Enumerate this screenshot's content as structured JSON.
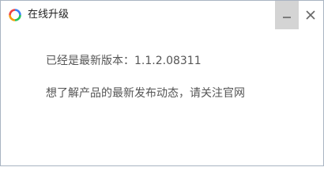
{
  "window": {
    "title": "在线升级",
    "minimize_icon": "minimize-icon",
    "close_icon": "close-icon"
  },
  "content": {
    "version_text": "已经是最新版本：1.1.2.08311",
    "follow_text": "想了解产品的最新发布动态，请关注官网"
  },
  "colors": {
    "app_icon": [
      "#3b82f6",
      "#22c55e",
      "#f59e0b",
      "#ef4444"
    ],
    "minimize_button_bg": "#d4d4d4",
    "text": "#555555"
  }
}
